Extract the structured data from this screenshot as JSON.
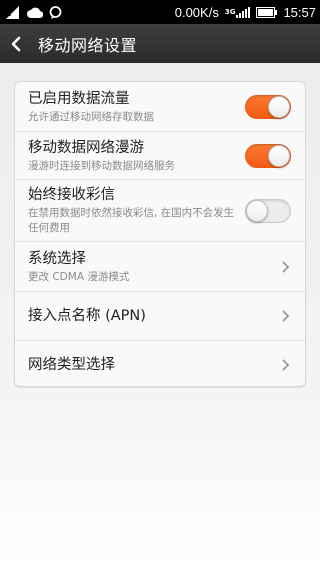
{
  "status_bar": {
    "network_speed": "0.00K/s",
    "network_type": "3G",
    "time": "15:57",
    "icons": [
      "signal-unknown-icon",
      "cloud-icon",
      "message-icon",
      "signal-strength-icon",
      "battery-icon"
    ]
  },
  "header": {
    "title": "移动网络设置",
    "back_icon": "back-arrow-icon"
  },
  "settings": [
    {
      "title": "已启用数据流量",
      "subtitle": "允许通过移动网络存取数据",
      "control": "toggle",
      "value": true
    },
    {
      "title": "移动数据网络漫游",
      "subtitle": "漫游时连接到移动数据网络服务",
      "control": "toggle",
      "value": true
    },
    {
      "title": "始终接收彩信",
      "subtitle": "在禁用数据时依然接收彩信, 在国内不会发生任何费用",
      "control": "toggle",
      "value": false
    },
    {
      "title": "系统选择",
      "subtitle": "更改 CDMA 漫游模式",
      "control": "chevron"
    },
    {
      "title": "接入点名称 (APN)",
      "subtitle": "",
      "control": "chevron"
    },
    {
      "title": "网络类型选择",
      "subtitle": "",
      "control": "chevron"
    }
  ],
  "colors": {
    "toggle_on": "#f25a12",
    "toggle_off": "#ececec",
    "action_bar": "#333333",
    "status_bar": "#000000"
  }
}
